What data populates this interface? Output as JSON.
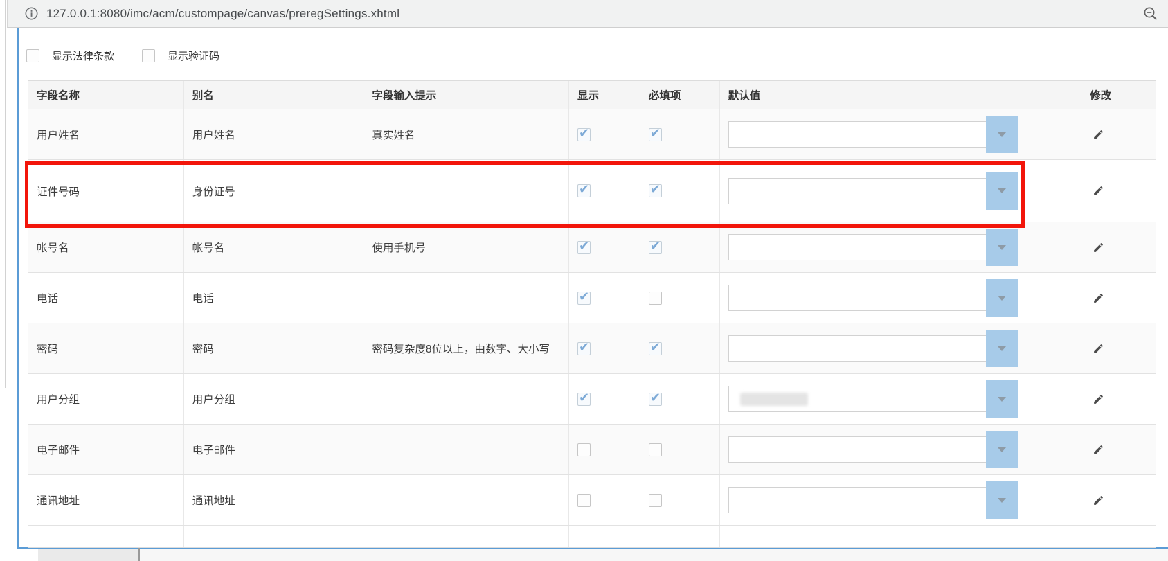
{
  "browser": {
    "url": "127.0.0.1:8080/imc/acm/custompage/canvas/preregSettings.xhtml",
    "info_icon": "info-icon",
    "zoom_out_icon": "zoom-out-icon"
  },
  "colors": {
    "frame_blue": "#5b9cd6",
    "dropdown_button_blue": "#a7cbe9",
    "checkmark_blue": "#7ca9d6",
    "annotation_red": "#f2150a"
  },
  "options": [
    {
      "label": "显示法律条款",
      "checked": false
    },
    {
      "label": "显示验证码",
      "checked": false
    }
  ],
  "table": {
    "headers": [
      "字段名称",
      "别名",
      "字段输入提示",
      "显示",
      "必填项",
      "默认值",
      "修改"
    ],
    "rows": [
      {
        "name": "用户姓名",
        "alias": "用户姓名",
        "hint": "真实姓名",
        "display": true,
        "required": true,
        "default_value": "",
        "redacted": false,
        "highlighted": false
      },
      {
        "name": "证件号码",
        "alias": "身份证号",
        "hint": "",
        "display": true,
        "required": true,
        "default_value": "",
        "redacted": false,
        "highlighted": true
      },
      {
        "name": "帐号名",
        "alias": "帐号名",
        "hint": "使用手机号",
        "display": true,
        "required": true,
        "default_value": "",
        "redacted": false,
        "highlighted": false
      },
      {
        "name": "电话",
        "alias": "电话",
        "hint": "",
        "display": true,
        "required": false,
        "default_value": "",
        "redacted": false,
        "highlighted": false
      },
      {
        "name": "密码",
        "alias": "密码",
        "hint": "密码复杂度8位以上，由数字、大小写",
        "display": true,
        "required": true,
        "default_value": "",
        "redacted": false,
        "highlighted": false
      },
      {
        "name": "用户分组",
        "alias": "用户分组",
        "hint": "",
        "display": true,
        "required": true,
        "default_value": "",
        "redacted": true,
        "highlighted": false
      },
      {
        "name": "电子邮件",
        "alias": "电子邮件",
        "hint": "",
        "display": false,
        "required": false,
        "default_value": "",
        "redacted": false,
        "highlighted": false
      },
      {
        "name": "通讯地址",
        "alias": "通讯地址",
        "hint": "",
        "display": false,
        "required": false,
        "default_value": "",
        "redacted": false,
        "highlighted": false
      }
    ]
  }
}
